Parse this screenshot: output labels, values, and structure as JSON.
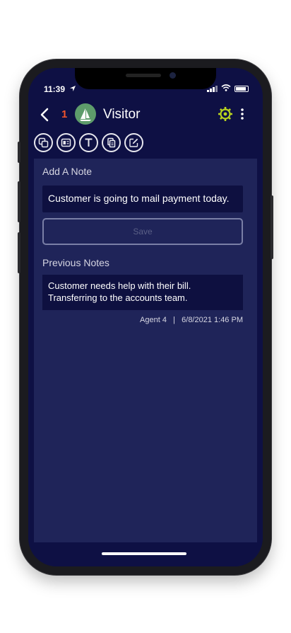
{
  "status_bar": {
    "time": "11:39"
  },
  "header": {
    "back_icon": "chevron-left-icon",
    "unread_count": "1",
    "title": "Visitor",
    "accent": "#b9d31f"
  },
  "toolbar": {
    "icons": [
      "copy-icon",
      "card-icon",
      "text-icon",
      "document-icon",
      "edit-icon"
    ]
  },
  "add_note": {
    "label": "Add A Note",
    "value": "Customer is going to mail payment today.",
    "save_label": "Save"
  },
  "previous_notes": {
    "label": "Previous Notes",
    "items": [
      {
        "text": "Customer needs help with their bill. Transferring to the accounts team.",
        "meta": "Agent 4   |   6/8/2021 1:46 PM"
      }
    ]
  }
}
